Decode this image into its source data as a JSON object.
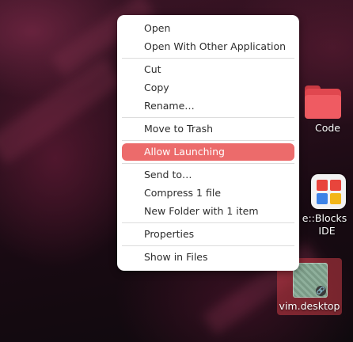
{
  "context_menu": {
    "items": [
      {
        "label": "Open"
      },
      {
        "label": "Open With Other Application"
      },
      {
        "label": "Cut"
      },
      {
        "label": "Copy"
      },
      {
        "label": "Rename…"
      },
      {
        "label": "Move to Trash"
      },
      {
        "label": "Allow Launching",
        "highlighted": true
      },
      {
        "label": "Send to…"
      },
      {
        "label": "Compress 1 file"
      },
      {
        "label": "New Folder with 1 item"
      },
      {
        "label": "Properties"
      },
      {
        "label": "Show in Files"
      }
    ]
  },
  "desktop": {
    "icons": [
      {
        "label": "Code",
        "icon": "folder-icon"
      },
      {
        "label_line1": "e::Blocks",
        "label_line2": "IDE",
        "icon": "codeblocks-icon"
      },
      {
        "label": "vim.desktop",
        "icon": "vim-desktop-icon",
        "selected": true
      }
    ]
  },
  "colors": {
    "highlight": "#ec6b6b",
    "selection": "#c83c46",
    "folder": "#ef5b62",
    "codeblocks_squares": [
      "#e8453c",
      "#e8453c",
      "#3b82e6",
      "#f2b619"
    ]
  }
}
